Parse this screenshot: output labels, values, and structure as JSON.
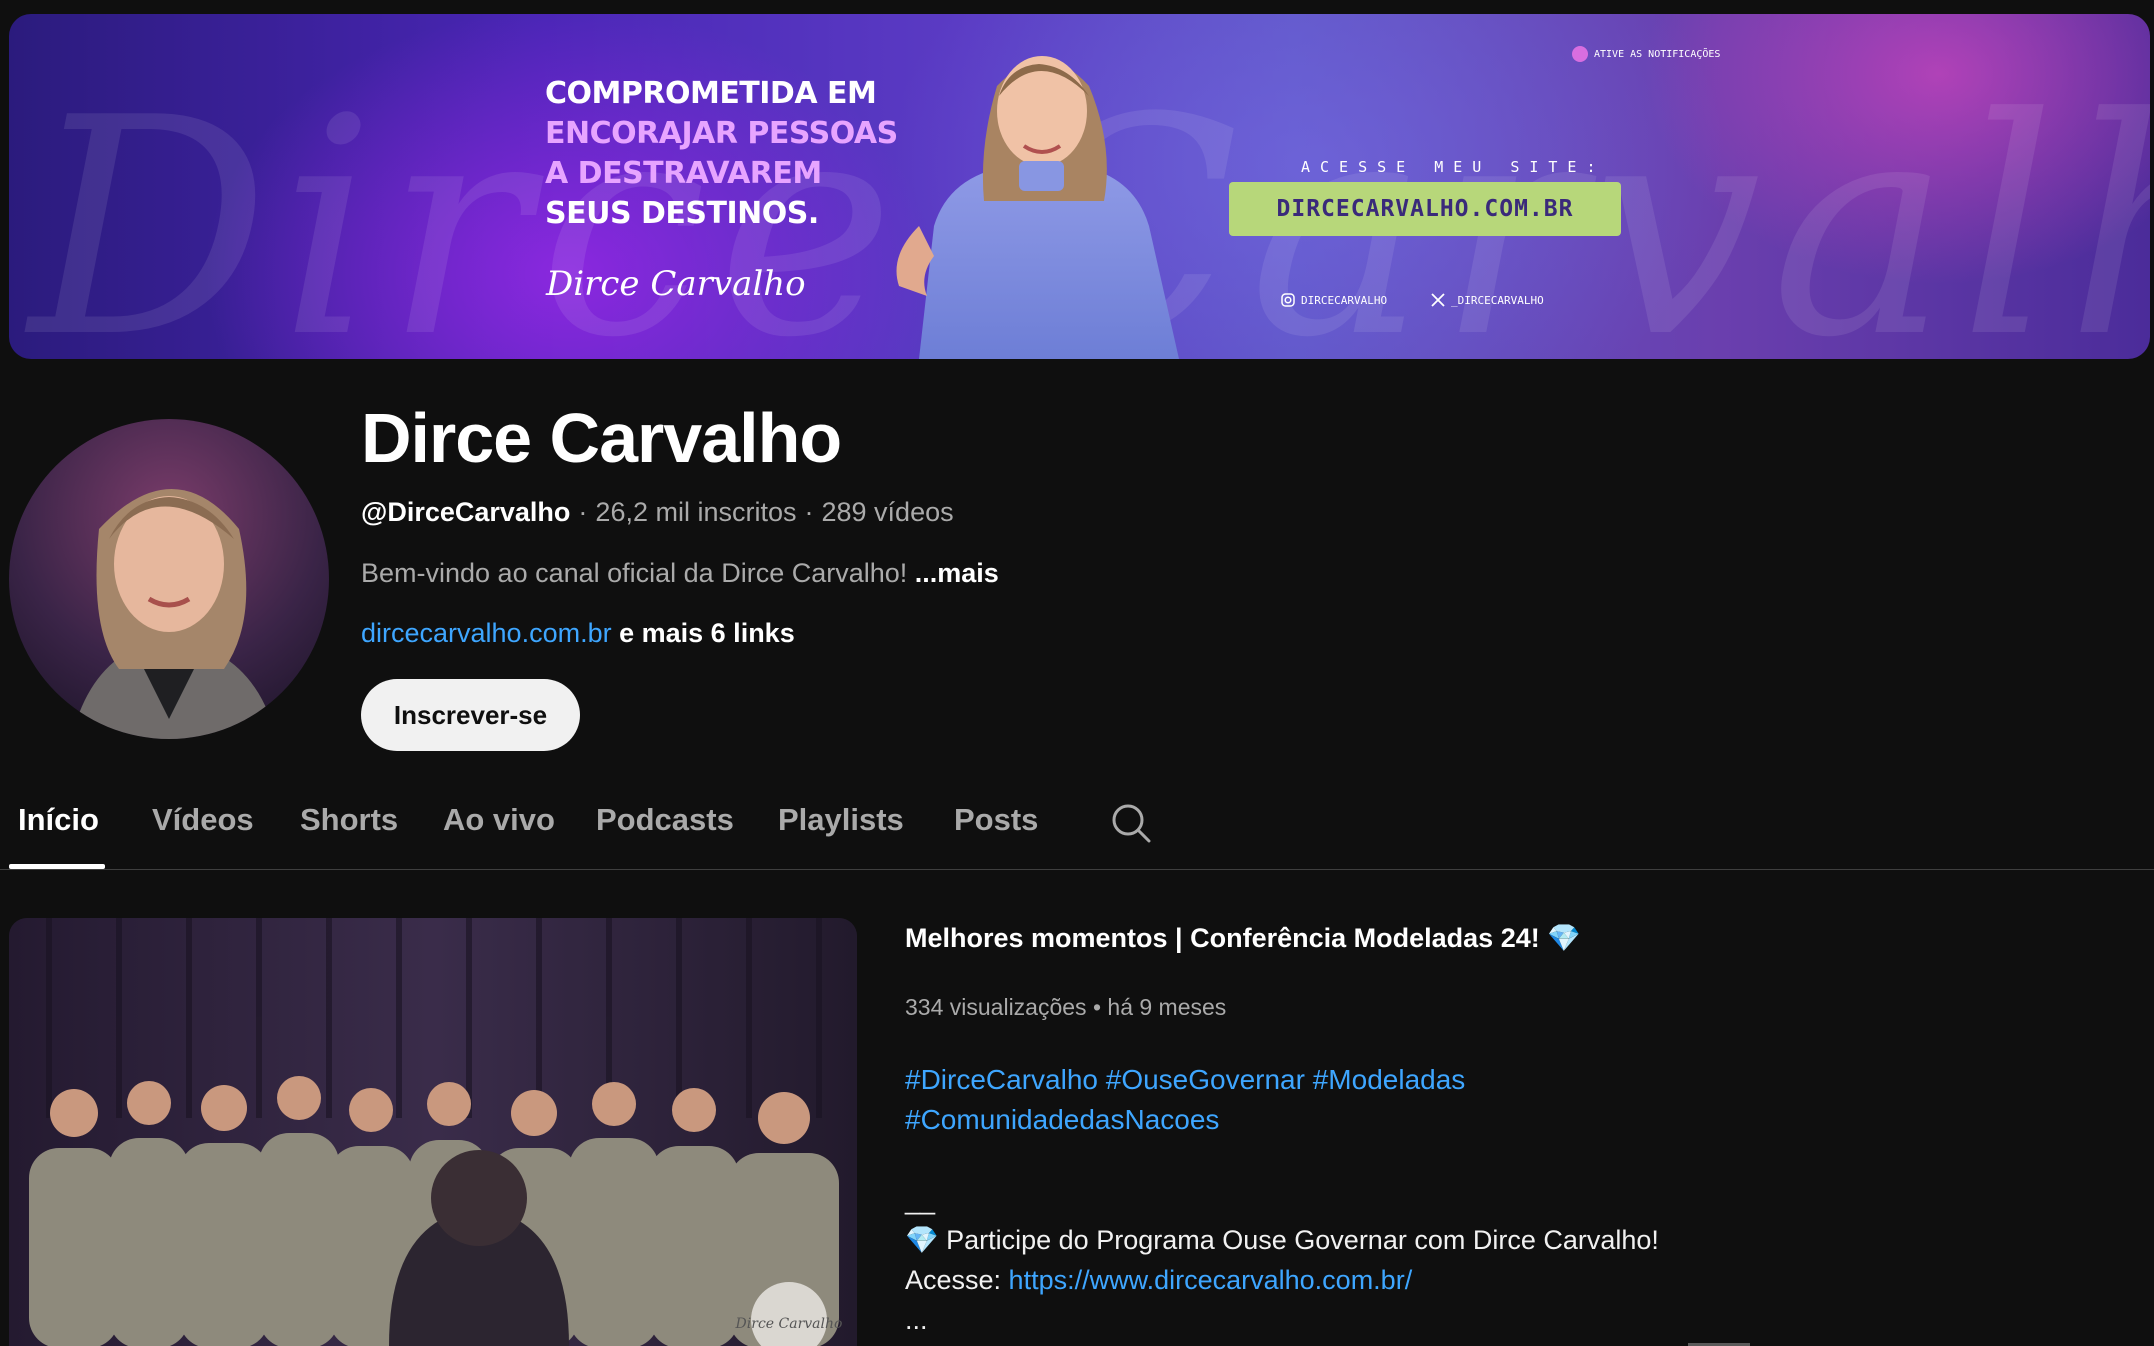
{
  "banner": {
    "headline_line1": "COMPROMETIDA EM",
    "headline_line2": "ENCORAJAR PESSOAS",
    "headline_line3": "A DESTRAVAREM",
    "headline_line4": "SEUS DESTINOS.",
    "signature": "Dirce Carvalho",
    "site_label": "ACESSE MEU SITE:",
    "site_button": "DIRCECARVALHO.COM.BR",
    "instagram": "DIRCECARVALHO",
    "x_handle": "_DIRCECARVALHO",
    "notify": "ATIVE AS NOTIFICAÇÕES",
    "background_script": "Dirce Carvalho",
    "colors": {
      "accent_pink": "#e7a4ff",
      "site_button": "#b7d77a"
    }
  },
  "channel": {
    "title": "Dirce Carvalho",
    "handle": "@DirceCarvalho",
    "subscribers": "26,2 mil inscritos",
    "videos": "289 vídeos",
    "separator": "·",
    "description": "Bem-vindo ao canal oficial da Dirce Carvalho!",
    "more_label": "...mais",
    "link": "dircecarvalho.com.br",
    "more_links": "e mais 6 links",
    "subscribe_label": "Inscrever-se"
  },
  "tabs": [
    {
      "label": "Início",
      "active": true
    },
    {
      "label": "Vídeos",
      "active": false
    },
    {
      "label": "Shorts",
      "active": false
    },
    {
      "label": "Ao vivo",
      "active": false
    },
    {
      "label": "Podcasts",
      "active": false
    },
    {
      "label": "Playlists",
      "active": false
    },
    {
      "label": "Posts",
      "active": false
    }
  ],
  "featured": {
    "title": "Melhores momentos | Conferência Modeladas 24! 💎",
    "views": "334 visualizações",
    "dot": "•",
    "age": "há 9 meses",
    "tags_line1": "#DirceCarvalho #OuseGovernar #Modeladas",
    "tags_line2": "#ComunidadedasNacoes",
    "dash": "__",
    "promo": "💎  Participe do Programa Ouse Governar com Dirce Carvalho!",
    "access_label": "Acesse: ",
    "access_url": "https://www.dircecarvalho.com.br/",
    "ellipsis": "...",
    "watermark": "Dirce Carvalho"
  },
  "colors": {
    "background": "#0f0f0f",
    "link_blue": "#3ea6ff",
    "muted_text": "#aaaaaa"
  }
}
